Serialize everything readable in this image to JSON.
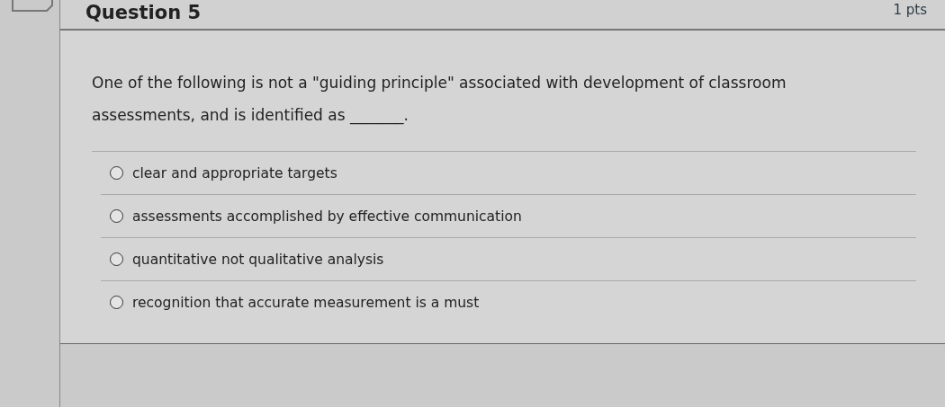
{
  "question": {
    "title": "Question 5",
    "points": "1 pts",
    "prompt": "One of the following is not a \"guiding principle\" associated with development of classroom assessments, and is identified as _______.",
    "options": [
      {
        "label": "clear and appropriate targets",
        "selected": false
      },
      {
        "label": "assessments accomplished by effective communication",
        "selected": false
      },
      {
        "label": "quantitative not qualitative analysis",
        "selected": false
      },
      {
        "label": "recognition that accurate measurement is a must",
        "selected": false
      }
    ]
  }
}
